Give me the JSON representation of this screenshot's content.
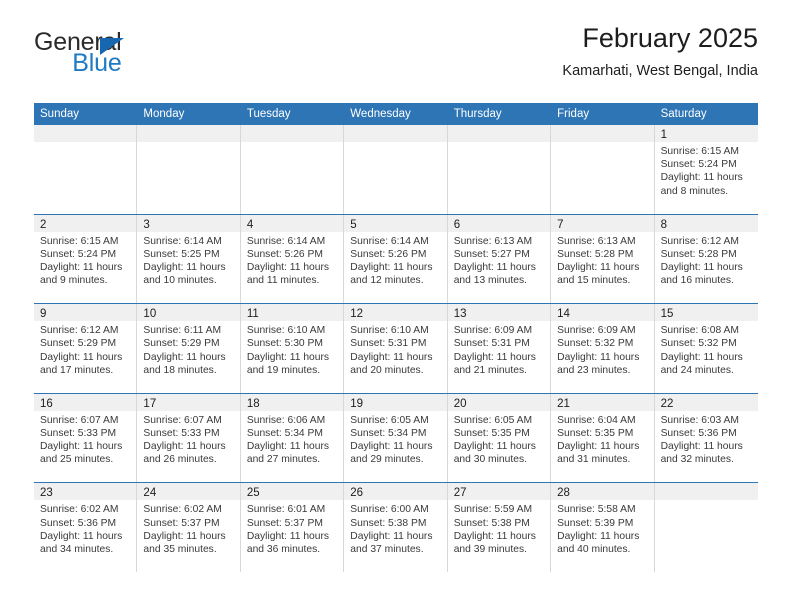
{
  "brand": {
    "name_top": "General",
    "name_bottom": "Blue",
    "accent_color": "#1f7ac4"
  },
  "header": {
    "title": "February 2025",
    "subtitle": "Kamarhati, West Bengal, India"
  },
  "calendar": {
    "header_color": "#2e75b6",
    "weekdays": [
      "Sunday",
      "Monday",
      "Tuesday",
      "Wednesday",
      "Thursday",
      "Friday",
      "Saturday"
    ],
    "weeks": [
      [
        {
          "day": "",
          "empty": true
        },
        {
          "day": "",
          "empty": true
        },
        {
          "day": "",
          "empty": true
        },
        {
          "day": "",
          "empty": true
        },
        {
          "day": "",
          "empty": true
        },
        {
          "day": "",
          "empty": true
        },
        {
          "day": "1",
          "sunrise": "Sunrise: 6:15 AM",
          "sunset": "Sunset: 5:24 PM",
          "daylight": "Daylight: 11 hours and 8 minutes."
        }
      ],
      [
        {
          "day": "2",
          "sunrise": "Sunrise: 6:15 AM",
          "sunset": "Sunset: 5:24 PM",
          "daylight": "Daylight: 11 hours and 9 minutes."
        },
        {
          "day": "3",
          "sunrise": "Sunrise: 6:14 AM",
          "sunset": "Sunset: 5:25 PM",
          "daylight": "Daylight: 11 hours and 10 minutes."
        },
        {
          "day": "4",
          "sunrise": "Sunrise: 6:14 AM",
          "sunset": "Sunset: 5:26 PM",
          "daylight": "Daylight: 11 hours and 11 minutes."
        },
        {
          "day": "5",
          "sunrise": "Sunrise: 6:14 AM",
          "sunset": "Sunset: 5:26 PM",
          "daylight": "Daylight: 11 hours and 12 minutes."
        },
        {
          "day": "6",
          "sunrise": "Sunrise: 6:13 AM",
          "sunset": "Sunset: 5:27 PM",
          "daylight": "Daylight: 11 hours and 13 minutes."
        },
        {
          "day": "7",
          "sunrise": "Sunrise: 6:13 AM",
          "sunset": "Sunset: 5:28 PM",
          "daylight": "Daylight: 11 hours and 15 minutes."
        },
        {
          "day": "8",
          "sunrise": "Sunrise: 6:12 AM",
          "sunset": "Sunset: 5:28 PM",
          "daylight": "Daylight: 11 hours and 16 minutes."
        }
      ],
      [
        {
          "day": "9",
          "sunrise": "Sunrise: 6:12 AM",
          "sunset": "Sunset: 5:29 PM",
          "daylight": "Daylight: 11 hours and 17 minutes."
        },
        {
          "day": "10",
          "sunrise": "Sunrise: 6:11 AM",
          "sunset": "Sunset: 5:29 PM",
          "daylight": "Daylight: 11 hours and 18 minutes."
        },
        {
          "day": "11",
          "sunrise": "Sunrise: 6:10 AM",
          "sunset": "Sunset: 5:30 PM",
          "daylight": "Daylight: 11 hours and 19 minutes."
        },
        {
          "day": "12",
          "sunrise": "Sunrise: 6:10 AM",
          "sunset": "Sunset: 5:31 PM",
          "daylight": "Daylight: 11 hours and 20 minutes."
        },
        {
          "day": "13",
          "sunrise": "Sunrise: 6:09 AM",
          "sunset": "Sunset: 5:31 PM",
          "daylight": "Daylight: 11 hours and 21 minutes."
        },
        {
          "day": "14",
          "sunrise": "Sunrise: 6:09 AM",
          "sunset": "Sunset: 5:32 PM",
          "daylight": "Daylight: 11 hours and 23 minutes."
        },
        {
          "day": "15",
          "sunrise": "Sunrise: 6:08 AM",
          "sunset": "Sunset: 5:32 PM",
          "daylight": "Daylight: 11 hours and 24 minutes."
        }
      ],
      [
        {
          "day": "16",
          "sunrise": "Sunrise: 6:07 AM",
          "sunset": "Sunset: 5:33 PM",
          "daylight": "Daylight: 11 hours and 25 minutes."
        },
        {
          "day": "17",
          "sunrise": "Sunrise: 6:07 AM",
          "sunset": "Sunset: 5:33 PM",
          "daylight": "Daylight: 11 hours and 26 minutes."
        },
        {
          "day": "18",
          "sunrise": "Sunrise: 6:06 AM",
          "sunset": "Sunset: 5:34 PM",
          "daylight": "Daylight: 11 hours and 27 minutes."
        },
        {
          "day": "19",
          "sunrise": "Sunrise: 6:05 AM",
          "sunset": "Sunset: 5:34 PM",
          "daylight": "Daylight: 11 hours and 29 minutes."
        },
        {
          "day": "20",
          "sunrise": "Sunrise: 6:05 AM",
          "sunset": "Sunset: 5:35 PM",
          "daylight": "Daylight: 11 hours and 30 minutes."
        },
        {
          "day": "21",
          "sunrise": "Sunrise: 6:04 AM",
          "sunset": "Sunset: 5:35 PM",
          "daylight": "Daylight: 11 hours and 31 minutes."
        },
        {
          "day": "22",
          "sunrise": "Sunrise: 6:03 AM",
          "sunset": "Sunset: 5:36 PM",
          "daylight": "Daylight: 11 hours and 32 minutes."
        }
      ],
      [
        {
          "day": "23",
          "sunrise": "Sunrise: 6:02 AM",
          "sunset": "Sunset: 5:36 PM",
          "daylight": "Daylight: 11 hours and 34 minutes."
        },
        {
          "day": "24",
          "sunrise": "Sunrise: 6:02 AM",
          "sunset": "Sunset: 5:37 PM",
          "daylight": "Daylight: 11 hours and 35 minutes."
        },
        {
          "day": "25",
          "sunrise": "Sunrise: 6:01 AM",
          "sunset": "Sunset: 5:37 PM",
          "daylight": "Daylight: 11 hours and 36 minutes."
        },
        {
          "day": "26",
          "sunrise": "Sunrise: 6:00 AM",
          "sunset": "Sunset: 5:38 PM",
          "daylight": "Daylight: 11 hours and 37 minutes."
        },
        {
          "day": "27",
          "sunrise": "Sunrise: 5:59 AM",
          "sunset": "Sunset: 5:38 PM",
          "daylight": "Daylight: 11 hours and 39 minutes."
        },
        {
          "day": "28",
          "sunrise": "Sunrise: 5:58 AM",
          "sunset": "Sunset: 5:39 PM",
          "daylight": "Daylight: 11 hours and 40 minutes."
        },
        {
          "day": "",
          "empty": true
        }
      ]
    ]
  }
}
